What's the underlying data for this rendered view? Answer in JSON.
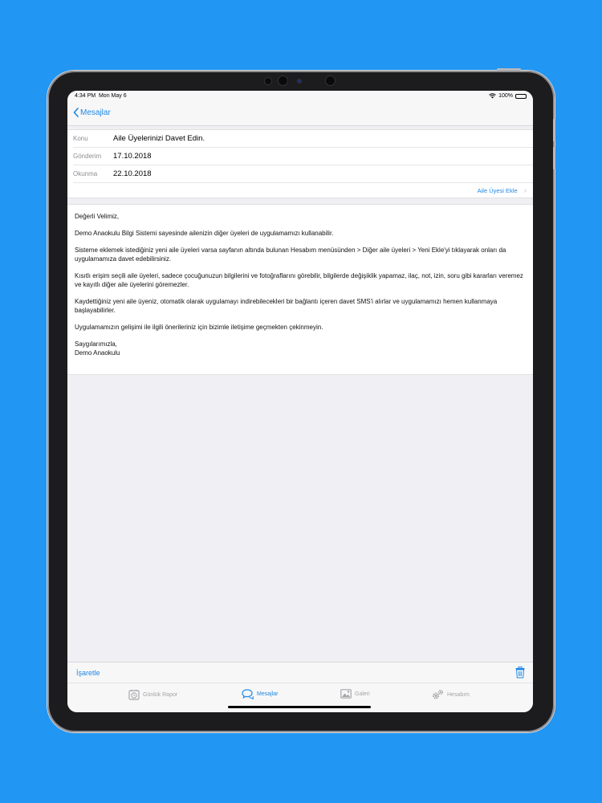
{
  "status_bar": {
    "time": "4:34 PM",
    "date": "Mon May 6",
    "battery": "100%"
  },
  "nav": {
    "back_label": "Mesajlar"
  },
  "message_meta": {
    "subject_label": "Konu",
    "subject": "Aile Üyelerinizi Davet Edin.",
    "sent_label": "Gönderim",
    "sent": "17.10.2018",
    "read_label": "Okunma",
    "read": "22.10.2018",
    "add_member_label": "Aile Üyesi Ekle"
  },
  "message_body": {
    "greeting": "Değerli Velimiz,",
    "p1": "Demo Anaokulu Bilgi Sistemi sayesinde ailenizin diğer üyeleri de uygulamamızı kullanabilir.",
    "p2": "Sisteme eklemek istediğiniz yeni aile üyeleri varsa sayfanın altında bulunan Hesabım menüsünden > Diğer aile üyeleri > Yeni Ekle'yi tıklayarak onları da uygulamamıza davet edebilirsiniz.",
    "p3": "Kısıtlı erişim seçili aile üyeleri, sadece çocuğunuzun bilgilerini ve fotoğraflarını görebilir,  bilgilerde değişiklik yapamaz, ilaç, not, izin, soru gibi kararları veremez ve kayıtlı diğer aile üyelerini göremezler.",
    "p4": "Kaydettiğiniz yeni aile üyeniz, otomatik olarak uygulamayı indirebilecekleri bir bağlantı içeren davet SMS'i alırlar ve uygulamamızı hemen kullanmaya başlayabilirler.",
    "p5": "Uygulamamızın gelişimi ile ilgili önerileriniz için bizimle iletişime geçmekten çekinmeyin.",
    "signoff": "Saygılarımızla,",
    "signature": "Demo Anaokulu"
  },
  "toolbar": {
    "mark_label": "İşaretle",
    "trash_icon": "trash-icon"
  },
  "tabs": [
    {
      "label": "Günlük Rapor",
      "icon": "clock-report-icon",
      "active": false
    },
    {
      "label": "Mesajlar",
      "icon": "chat-bubbles-icon",
      "active": true
    },
    {
      "label": "Galeri",
      "icon": "photo-icon",
      "active": false
    },
    {
      "label": "Hesabım",
      "icon": "gears-icon",
      "active": false
    }
  ],
  "colors": {
    "background": "#2196f3",
    "accent": "#1e88e5",
    "inactive_tab": "#a5a5aa"
  }
}
